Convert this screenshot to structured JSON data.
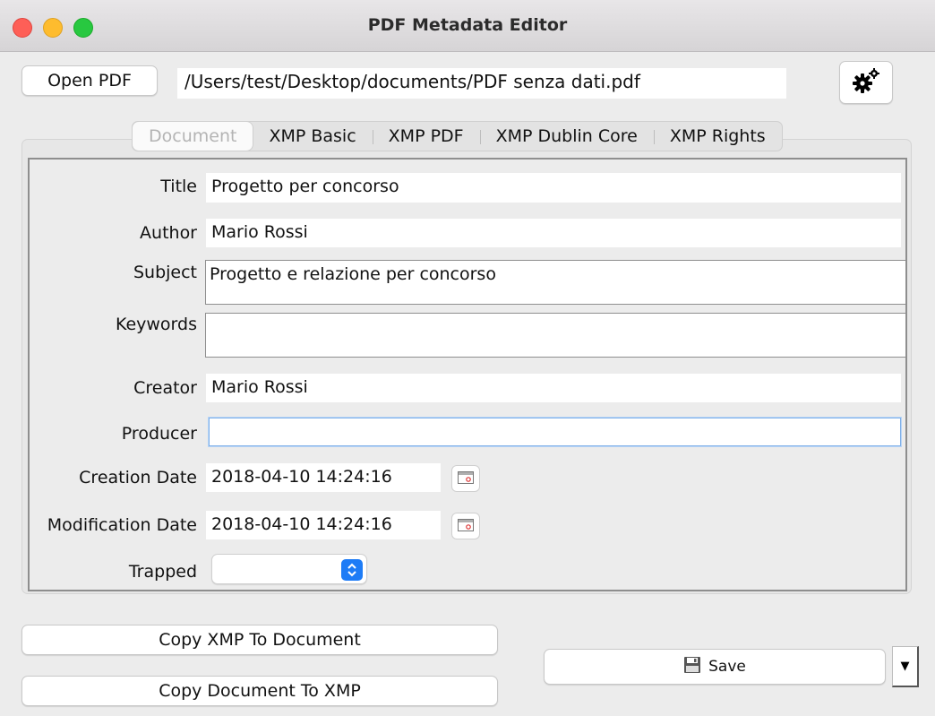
{
  "window": {
    "title": "PDF Metadata Editor"
  },
  "toolbar": {
    "open_label": "Open PDF",
    "file_path": "/Users/test/Desktop/documents/PDF senza dati.pdf",
    "settings_icon": "gears-icon"
  },
  "tabs": [
    {
      "label": "Document",
      "active": true
    },
    {
      "label": "XMP Basic",
      "active": false
    },
    {
      "label": "XMP PDF",
      "active": false
    },
    {
      "label": "XMP Dublin Core",
      "active": false
    },
    {
      "label": "XMP Rights",
      "active": false
    }
  ],
  "form": {
    "title": {
      "label": "Title",
      "value": "Progetto per concorso"
    },
    "author": {
      "label": "Author",
      "value": "Mario Rossi"
    },
    "subject": {
      "label": "Subject",
      "value": "Progetto e relazione per concorso"
    },
    "keywords": {
      "label": "Keywords",
      "value": ""
    },
    "creator": {
      "label": "Creator",
      "value": "Mario Rossi"
    },
    "producer": {
      "label": "Producer",
      "value": ""
    },
    "creation_date": {
      "label": "Creation Date",
      "value": "2018-04-10 14:24:16"
    },
    "modification_date": {
      "label": "Modification Date",
      "value": "2018-04-10 14:24:16"
    },
    "trapped": {
      "label": "Trapped",
      "value": ""
    }
  },
  "actions": {
    "copy_xmp_to_doc": "Copy XMP To Document",
    "copy_doc_to_xmp": "Copy Document To XMP",
    "save_label": "Save"
  },
  "colors": {
    "accent": "#1e7cf6",
    "focus": "#7fb0e8"
  }
}
